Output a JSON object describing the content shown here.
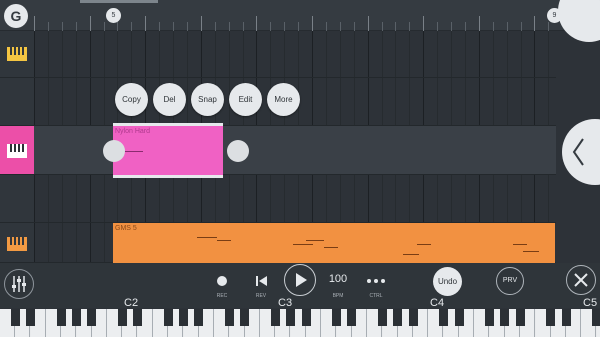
{
  "app": {
    "logo_glyph": "G",
    "brand_icon": "fl-fruit-icon"
  },
  "ruler": {
    "markers": [
      {
        "label": "5"
      },
      {
        "label": "9"
      }
    ]
  },
  "tracks": [
    {
      "instrument": "keyboard-icon",
      "color": "#f4c542"
    },
    {
      "instrument": "keyboard-icon",
      "color": "#ffffff",
      "header_bg": "#ec4fa8",
      "selected": true
    },
    {
      "instrument": "keyboard-icon",
      "color": "#f29a43"
    }
  ],
  "clips": [
    {
      "name": "Nylon Hard",
      "color": "#f061c4",
      "selected": true
    },
    {
      "name": "GMS 5",
      "color": "#f29141"
    }
  ],
  "context_menu": {
    "buttons": [
      {
        "label": "Copy"
      },
      {
        "label": "Del"
      },
      {
        "label": "Snap"
      },
      {
        "label": "Edit"
      },
      {
        "label": "More"
      }
    ]
  },
  "transport": {
    "rec_label": "REC",
    "rev_label": "REV",
    "bpm_value": "100",
    "bpm_label": "BPM",
    "ctrl_label": "CTRL",
    "undo_label": "Undo",
    "prv_label": "PRV"
  },
  "keyboard": {
    "octave_labels": [
      "C2",
      "C3",
      "C4",
      "C5"
    ]
  },
  "colors": {
    "accent": "#f061c4",
    "orange": "#f29141",
    "background": "#2d3238"
  }
}
